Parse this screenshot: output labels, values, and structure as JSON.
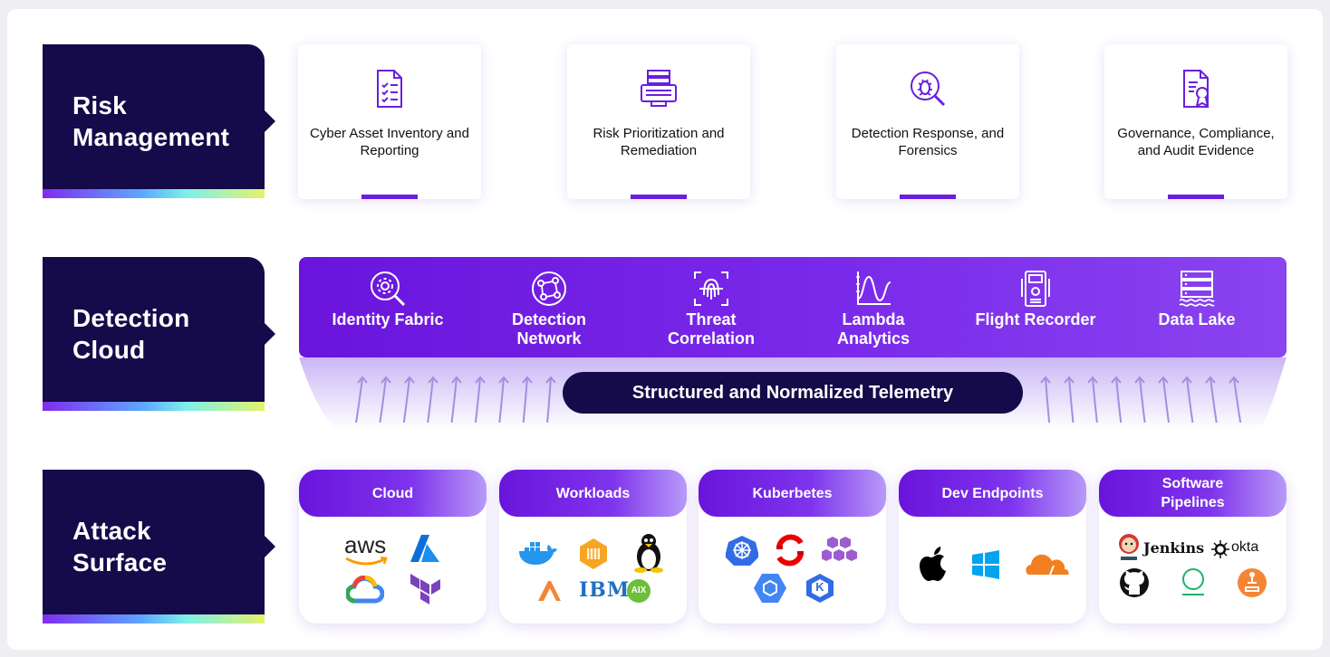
{
  "rows": {
    "risk": "Risk Management",
    "detection": "Detection Cloud",
    "attack": "Attack Surface"
  },
  "risk_cards": [
    {
      "label": "Cyber Asset Inventory and Reporting",
      "icon": "checklist-document-icon"
    },
    {
      "label": "Risk Prioritization and Remediation",
      "icon": "server-monitor-icon"
    },
    {
      "label": "Detection Response, and Forensics",
      "icon": "bug-magnifier-icon"
    },
    {
      "label": "Governance, Compliance, and Audit Evidence",
      "icon": "certificate-document-icon"
    }
  ],
  "detection_items": [
    {
      "label": "Identity Fabric",
      "icon": "gear-magnifier-icon"
    },
    {
      "label": "Detection Network",
      "icon": "network-globe-icon"
    },
    {
      "label": "Threat Correlation",
      "icon": "fingerprint-icon"
    },
    {
      "label": "Lambda Analytics",
      "icon": "wave-chart-icon"
    },
    {
      "label": "Flight Recorder",
      "icon": "flight-recorder-icon"
    },
    {
      "label": "Data Lake",
      "icon": "database-lake-icon"
    }
  ],
  "telemetry": "Structured and Normalized Telemetry",
  "attack_cards": [
    {
      "title": "Cloud",
      "logos": [
        "aws-logo",
        "azure-logo",
        "google-cloud-logo",
        "terraform-logo"
      ],
      "aws_text": "aws"
    },
    {
      "title": "Workloads",
      "logos": [
        "docker-logo",
        "container-logo",
        "linux-logo",
        "lambda-logo",
        "ibm-logo",
        "aix-logo"
      ],
      "ibm_text": "IBM",
      "aix_text": "AIX"
    },
    {
      "title": "Kuberbetes",
      "logos": [
        "kubernetes-logo",
        "openshift-logo",
        "eks-logo",
        "gke-logo",
        "k-logo"
      ],
      "k_text": "K"
    },
    {
      "title": "Dev Endpoints",
      "logos": [
        "apple-logo",
        "windows-logo",
        "cloudflare-logo"
      ]
    },
    {
      "title": "Software Pipelines",
      "logos": [
        "jenkins-logo",
        "okta-logo",
        "github-logo",
        "circle-logo",
        "pipeline-logo"
      ],
      "jenkins_text": "Jenkins",
      "okta_text": "okta"
    }
  ],
  "colors": {
    "navy": "#150a4a",
    "purple": "#6a14dc",
    "accent_bar": "#6a1ee0"
  }
}
